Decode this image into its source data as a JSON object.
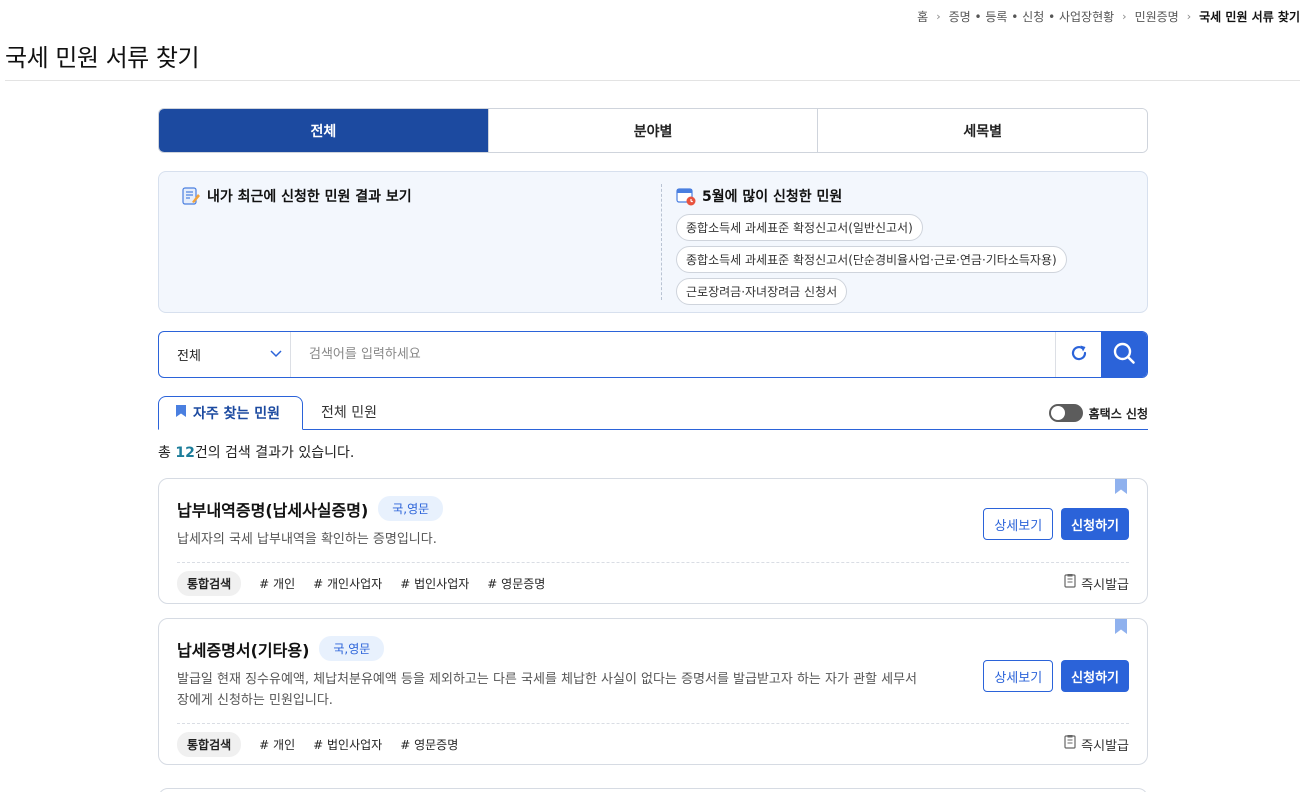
{
  "breadcrumb": [
    "홈",
    "증명 • 등록 • 신청 • 사업장현황",
    "민원증명",
    "국세 민원 서류 찾기"
  ],
  "page_title": "국세 민원 서류 찾기",
  "tabs": [
    {
      "label": "전체",
      "active": true
    },
    {
      "label": "분야별",
      "active": false
    },
    {
      "label": "세목별",
      "active": false
    }
  ],
  "recent": {
    "title": "내가 최근에 신청한 민원 결과 보기",
    "icon": "memo-pencil-icon"
  },
  "popular": {
    "title": "5월에 많이 신청한 민원",
    "icon": "calendar-clock-icon",
    "items": [
      "종합소득세 과세표준 확정신고서(일반신고서)",
      "종합소득세 과세표준 확정신고서(단순경비율사업·근로·연금·기타소득자용)",
      "근로장려금·자녀장려금 신청서"
    ]
  },
  "search": {
    "select_value": "전체",
    "placeholder": "검색어를 입력하세요"
  },
  "subtabs": [
    {
      "label": "자주 찾는 민원",
      "active": true
    },
    {
      "label": "전체 민원",
      "active": false
    }
  ],
  "toggle_label": "홈택스 신청",
  "result": {
    "prefix": "총 ",
    "count": "12",
    "suffix": "건의 검색 결과가 있습니다."
  },
  "cards": [
    {
      "title": "납부내역증명(납세사실증명)",
      "lang": "국,영문",
      "desc": "납세자의 국세 납부내역을 확인하는 증명입니다.",
      "detail_label": "상세보기",
      "apply_label": "신청하기",
      "tag_main": "통합검색",
      "tags": [
        "# 개인",
        "# 개인사업자",
        "# 법인사업자",
        "# 영문증명"
      ],
      "instant": "즉시발급"
    },
    {
      "title": "납세증명서(기타용)",
      "lang": "국,영문",
      "desc": "발급일 현재 징수유예액, 체납처분유예액 등을 제외하고는 다른 국세를 체납한 사실이 없다는 증명서를 발급받고자 하는 자가 관할 세무서장에게 신청하는 민원입니다.",
      "detail_label": "상세보기",
      "apply_label": "신청하기",
      "tag_main": "통합검색",
      "tags": [
        "# 개인",
        "# 법인사업자",
        "# 영문증명"
      ],
      "instant": "즉시발급"
    }
  ],
  "colors": {
    "primary": "#2b63d9",
    "tab_active": "#1c4aa0",
    "info_bg": "#f3f7fd",
    "count": "#1c7d9a"
  }
}
